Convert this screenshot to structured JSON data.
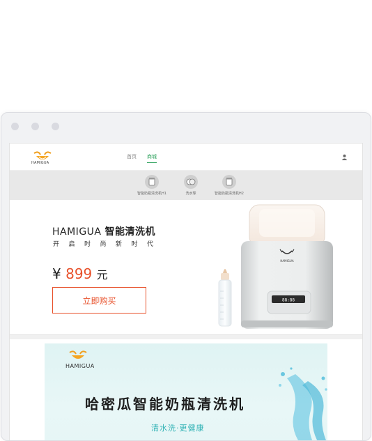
{
  "nav": {
    "home": "首页",
    "mall": "商城",
    "logo_text": "HAMIGUA"
  },
  "categories": [
    {
      "label": "智能奶瓶清洗机H1"
    },
    {
      "label": "洗水球"
    },
    {
      "label": "智能奶瓶清洗机H2"
    }
  ],
  "hero": {
    "brand": "HAMIGUA",
    "product": "智能清洗机",
    "slogan": "开启时尚新时代",
    "currency": "¥",
    "price": "899",
    "unit": "元",
    "buy_label": "立即购买",
    "device_logo_text": "HAMIGUA",
    "display_text": "88:88"
  },
  "banner": {
    "logo_text": "HAMIGUA",
    "title": "哈密瓜智能奶瓶清洗机",
    "subtitle": "清水洗·更健康"
  },
  "colors": {
    "accent": "#e8522c",
    "nav_active": "#2aa05a",
    "banner_sub": "#33b3b6"
  }
}
